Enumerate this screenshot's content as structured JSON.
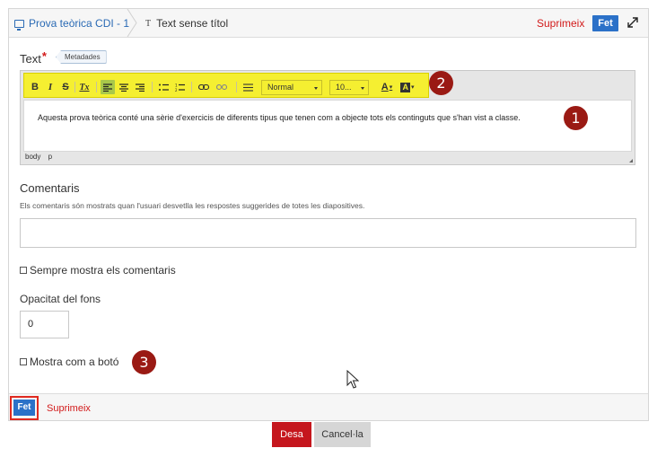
{
  "header": {
    "breadcrumb_presentation": "Prova teòrica CDI - 1",
    "breadcrumb_element": "Text sense títol",
    "element_icon": "T",
    "delete_label": "Suprimeix",
    "done_label": "Fet"
  },
  "text_field": {
    "label": "Text",
    "required_mark": "*",
    "metadata_tag": "Metadades",
    "content": "Aquesta prova teòrica conté una sèrie d'exercicis de diferents tipus que tenen com a objecte tots els continguts que s'han vist a classe.",
    "status_path": [
      "body",
      "p"
    ]
  },
  "toolbar": {
    "bold": "B",
    "italic": "I",
    "strike": "S",
    "clear_format": "Tx",
    "format_select": "Normal",
    "size_select": "10...",
    "text_color": "A",
    "bg_color": "A",
    "highlight_color": "#f5ef31"
  },
  "comments": {
    "label": "Comentaris",
    "help": "Els comentaris són mostrats quan l'usuari desvetlla les respostes suggerides de totes les diapositives.",
    "value": ""
  },
  "always_show_comments": {
    "label": "Sempre mostra els comentaris",
    "checked": false
  },
  "opacity": {
    "label": "Opacitat del fons",
    "value": "0"
  },
  "show_as_button": {
    "label": "Mostra com a botó",
    "checked": false
  },
  "markers": [
    "1",
    "2",
    "3"
  ],
  "footer": {
    "done_label": "Fet",
    "delete_label": "Suprimeix"
  },
  "actions": {
    "save_label": "Desa",
    "cancel_label": "Cancel·la"
  },
  "colors": {
    "accent_blue": "#2b71c8",
    "danger_red": "#d21a1a",
    "marker_red": "#9a1a14"
  }
}
